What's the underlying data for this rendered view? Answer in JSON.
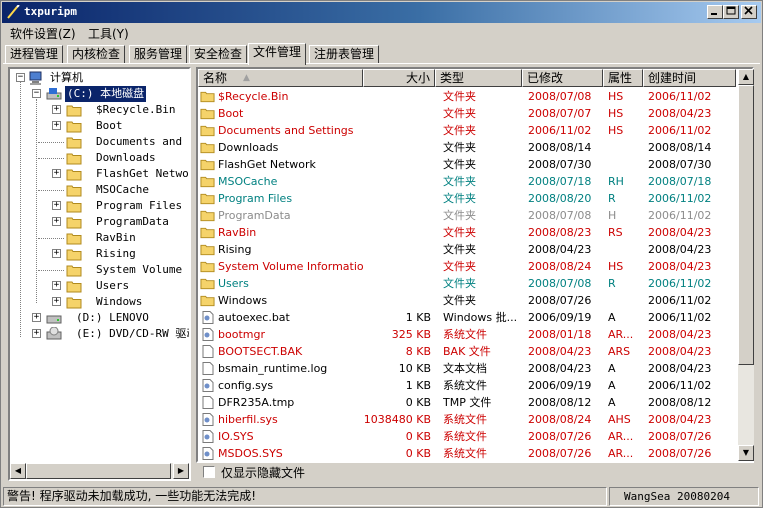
{
  "window": {
    "title": "txpuripm"
  },
  "menu": [
    "软件设置(Z)",
    "工具(Y)"
  ],
  "tabs": [
    {
      "label": "进程管理",
      "active": false
    },
    {
      "label": "内核检查",
      "active": false
    },
    {
      "label": "服务管理",
      "active": false
    },
    {
      "label": "安全检查",
      "active": false
    },
    {
      "label": "文件管理",
      "active": true
    },
    {
      "label": "注册表管理",
      "active": false
    }
  ],
  "tree": {
    "root": "计算机",
    "drive_c": "(C:)  本地磁盘",
    "c_children": [
      {
        "name": "$Recycle.Bin",
        "expandable": true
      },
      {
        "name": "Boot",
        "expandable": true
      },
      {
        "name": "Documents and Se",
        "expandable": false
      },
      {
        "name": "Downloads",
        "expandable": false
      },
      {
        "name": "FlashGet Network",
        "expandable": true
      },
      {
        "name": "MSOCache",
        "expandable": false
      },
      {
        "name": "Program Files",
        "expandable": true
      },
      {
        "name": "ProgramData",
        "expandable": true
      },
      {
        "name": "RavBin",
        "expandable": false
      },
      {
        "name": "Rising",
        "expandable": true
      },
      {
        "name": "System Volume In",
        "expandable": false
      },
      {
        "name": "Users",
        "expandable": true
      },
      {
        "name": "Windows",
        "expandable": true
      }
    ],
    "drive_d": "(D:)  LENOVO",
    "drive_e": "(E:)  DVD/CD-RW 驱动"
  },
  "columns": {
    "name": "名称",
    "size": "大小",
    "type": "类型",
    "modified": "已修改",
    "attr": "属性",
    "created": "创建时间"
  },
  "files": [
    {
      "name": "$Recycle.Bin",
      "size": "",
      "type": "文件夹",
      "modified": "2008/07/08",
      "attr": "HS",
      "created": "2006/11/02",
      "color": "red",
      "icon": "folder"
    },
    {
      "name": "Boot",
      "size": "",
      "type": "文件夹",
      "modified": "2008/07/07",
      "attr": "HS",
      "created": "2008/04/23",
      "color": "red",
      "icon": "folder"
    },
    {
      "name": "Documents and Settings",
      "size": "",
      "type": "文件夹",
      "modified": "2006/11/02",
      "attr": "HS",
      "created": "2006/11/02",
      "color": "red",
      "icon": "folder"
    },
    {
      "name": "Downloads",
      "size": "",
      "type": "文件夹",
      "modified": "2008/08/14",
      "attr": "",
      "created": "2008/08/14",
      "color": "black",
      "icon": "folder"
    },
    {
      "name": "FlashGet Network",
      "size": "",
      "type": "文件夹",
      "modified": "2008/07/30",
      "attr": "",
      "created": "2008/07/30",
      "color": "black",
      "icon": "folder"
    },
    {
      "name": "MSOCache",
      "size": "",
      "type": "文件夹",
      "modified": "2008/07/18",
      "attr": "RH",
      "created": "2008/07/18",
      "color": "teal",
      "icon": "folder"
    },
    {
      "name": "Program Files",
      "size": "",
      "type": "文件夹",
      "modified": "2008/08/20",
      "attr": "R",
      "created": "2006/11/02",
      "color": "teal",
      "icon": "folder"
    },
    {
      "name": "ProgramData",
      "size": "",
      "type": "文件夹",
      "modified": "2008/07/08",
      "attr": "H",
      "created": "2006/11/02",
      "color": "gray",
      "icon": "folder"
    },
    {
      "name": "RavBin",
      "size": "",
      "type": "文件夹",
      "modified": "2008/08/23",
      "attr": "RS",
      "created": "2008/04/23",
      "color": "red",
      "icon": "folder"
    },
    {
      "name": "Rising",
      "size": "",
      "type": "文件夹",
      "modified": "2008/04/23",
      "attr": "",
      "created": "2008/04/23",
      "color": "black",
      "icon": "folder"
    },
    {
      "name": "System Volume Information",
      "size": "",
      "type": "文件夹",
      "modified": "2008/08/24",
      "attr": "HS",
      "created": "2008/04/23",
      "color": "red",
      "icon": "folder"
    },
    {
      "name": "Users",
      "size": "",
      "type": "文件夹",
      "modified": "2008/07/08",
      "attr": "R",
      "created": "2006/11/02",
      "color": "teal",
      "icon": "folder"
    },
    {
      "name": "Windows",
      "size": "",
      "type": "文件夹",
      "modified": "2008/07/26",
      "attr": "",
      "created": "2006/11/02",
      "color": "black",
      "icon": "folder"
    },
    {
      "name": "autoexec.bat",
      "size": "1 KB",
      "type": "Windows 批...",
      "modified": "2006/09/19",
      "attr": "A",
      "created": "2006/11/02",
      "color": "black",
      "icon": "config-file"
    },
    {
      "name": "bootmgr",
      "size": "325 KB",
      "type": "系统文件",
      "modified": "2008/01/18",
      "attr": "AR...",
      "created": "2008/04/23",
      "color": "red",
      "icon": "config-file"
    },
    {
      "name": "BOOTSECT.BAK",
      "size": "8 KB",
      "type": "BAK 文件",
      "modified": "2008/04/23",
      "attr": "ARS",
      "created": "2008/04/23",
      "color": "red",
      "icon": "blank-file"
    },
    {
      "name": "bsmain_runtime.log",
      "size": "10 KB",
      "type": "文本文档",
      "modified": "2008/04/23",
      "attr": "A",
      "created": "2008/04/23",
      "color": "black",
      "icon": "blank-file"
    },
    {
      "name": "config.sys",
      "size": "1 KB",
      "type": "系统文件",
      "modified": "2006/09/19",
      "attr": "A",
      "created": "2006/11/02",
      "color": "black",
      "icon": "config-file"
    },
    {
      "name": "DFR235A.tmp",
      "size": "0 KB",
      "type": "TMP 文件",
      "modified": "2008/08/12",
      "attr": "A",
      "created": "2008/08/12",
      "color": "black",
      "icon": "blank-file"
    },
    {
      "name": "hiberfil.sys",
      "size": "1038480 KB",
      "type": "系统文件",
      "modified": "2008/08/24",
      "attr": "AHS",
      "created": "2008/04/23",
      "color": "red",
      "icon": "config-file"
    },
    {
      "name": "IO.SYS",
      "size": "0 KB",
      "type": "系统文件",
      "modified": "2008/07/26",
      "attr": "AR...",
      "created": "2008/07/26",
      "color": "red",
      "icon": "config-file"
    },
    {
      "name": "MSDOS.SYS",
      "size": "0 KB",
      "type": "系统文件",
      "modified": "2008/07/26",
      "attr": "AR...",
      "created": "2008/07/26",
      "color": "red",
      "icon": "config-file"
    }
  ],
  "options": {
    "show_hidden_only": "仅显示隐藏文件"
  },
  "status": {
    "message": "警告! 程序驱动未加载成功, 一些功能无法完成!",
    "author": "WangSea 20080204"
  }
}
